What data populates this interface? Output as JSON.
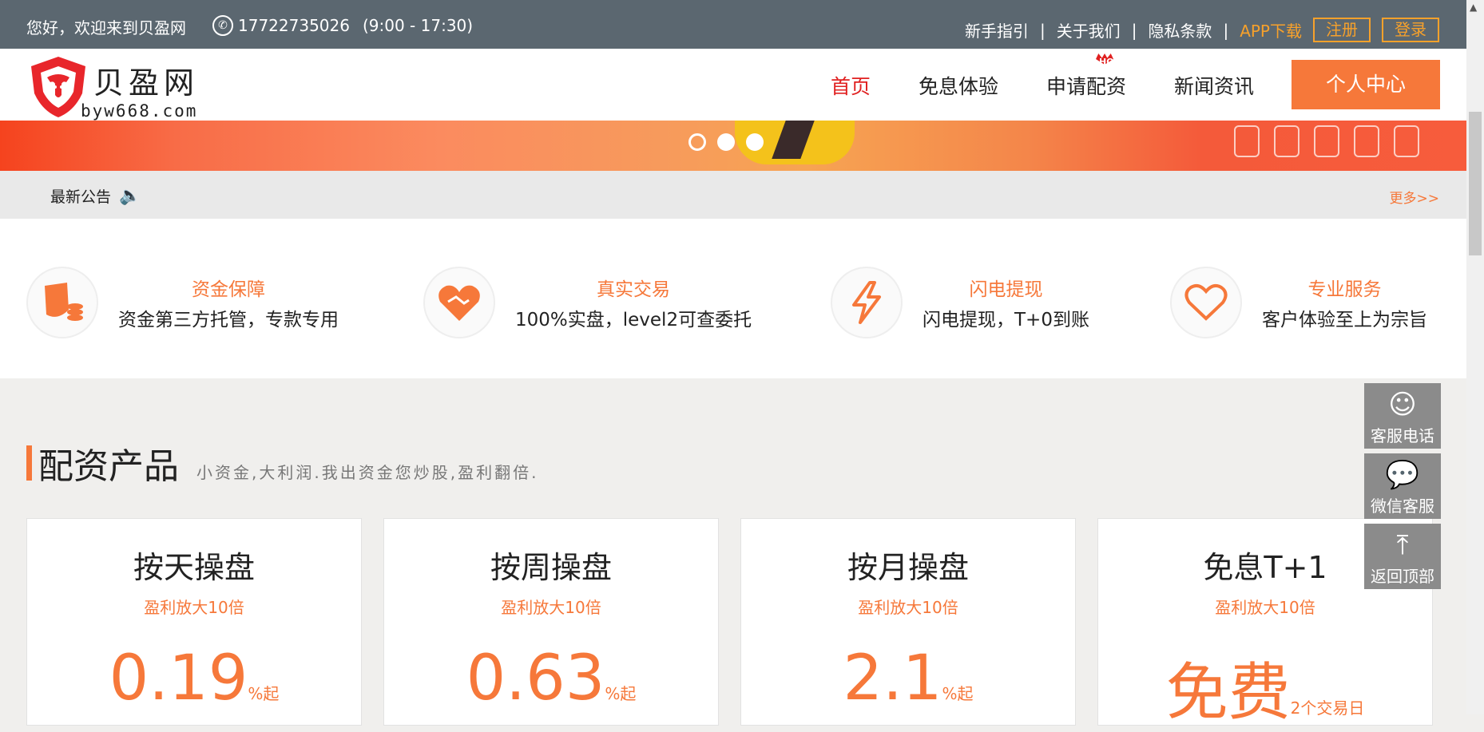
{
  "topbar": {
    "welcome": "您好，欢迎来到贝盈网",
    "phone": "17722735026",
    "hours": "(9:00 - 17:30)",
    "links": [
      "新手指引",
      "关于我们",
      "隐私条款"
    ],
    "app_download": "APP下载",
    "register": "注册",
    "login": "登录"
  },
  "header": {
    "logo_text": "贝盈网",
    "logo_domain": "byw668.com",
    "nav": [
      "首页",
      "免息体验",
      "申请配资",
      "新闻资讯"
    ],
    "nav_hot_badge": "HOT",
    "personal_center": "个人中心"
  },
  "banner": {
    "slides_count": 3,
    "active_slide": 1
  },
  "notice": {
    "label": "最新公告",
    "more": "更多>>"
  },
  "features": [
    {
      "icon": "shield-coins-icon",
      "title": "资金保障",
      "desc": "资金第三方托管，专款专用"
    },
    {
      "icon": "handshake-heart-icon",
      "title": "真实交易",
      "desc": "100%实盘，level2可查委托"
    },
    {
      "icon": "lightning-icon",
      "title": "闪电提现",
      "desc": "闪电提现，T+0到账"
    },
    {
      "icon": "heart-icon",
      "title": "专业服务",
      "desc": "客户体验至上为宗旨"
    }
  ],
  "products": {
    "title": "配资产品",
    "subtitle": "小资金,大利润.我出资金您炒股,盈利翻倍.",
    "cards": [
      {
        "name": "按天操盘",
        "tag": "盈利放大10倍",
        "price": "0.19",
        "unit": "%起"
      },
      {
        "name": "按周操盘",
        "tag": "盈利放大10倍",
        "price": "0.63",
        "unit": "%起"
      },
      {
        "name": "按月操盘",
        "tag": "盈利放大10倍",
        "price": "2.1",
        "unit": "%起"
      },
      {
        "name": "免息T+1",
        "tag": "盈利放大10倍",
        "price": "免费",
        "unit": "2个交易日"
      }
    ]
  },
  "sidebar": [
    {
      "icon": "headset-icon",
      "label": "客服电话"
    },
    {
      "icon": "wechat-icon",
      "label": "微信客服"
    },
    {
      "icon": "arrow-up-icon",
      "label": "返回顶部"
    }
  ],
  "colors": {
    "accent": "#f6783a",
    "topbar": "#5b6770",
    "nav_active": "#e02020",
    "gold": "#f7a12b"
  }
}
